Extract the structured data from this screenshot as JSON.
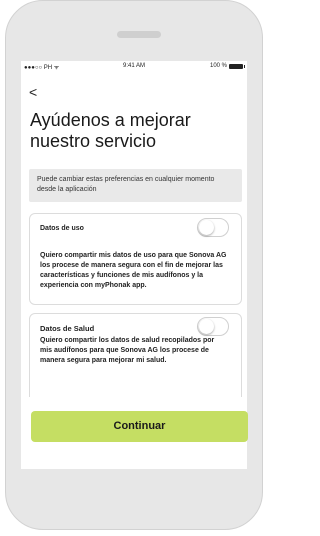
{
  "status_bar": {
    "carrier": "●●●○○ PH ᯤ",
    "time": "9:41 AM",
    "battery": "100 %"
  },
  "nav": {
    "back_glyph": "<"
  },
  "page": {
    "title": "Ayúdenos a mejorar nuestro servicio",
    "info_text": "Puede cambiar estas preferencias en cualquier momento desde la aplicación"
  },
  "cards": [
    {
      "title": "Datos de uso",
      "text": "Quiero compartir mis datos de uso para que Sonova AG los procese de manera segura con el fin de mejorar las características y funciones de mis audífonos y la experiencia con myPhonak app.",
      "toggle_on": false
    },
    {
      "title": "Datos de Salud",
      "text": "Quiero compartir los datos de salud recopilados por mis audífonos para que Sonova AG los procese de manera segura para mejorar mi salud.",
      "toggle_on": false
    }
  ],
  "actions": {
    "continue_label": "Continuar"
  },
  "colors": {
    "accent": "#c5de63",
    "info_bg": "#e9e9e9",
    "phone_frame": "#e7e7e7"
  }
}
